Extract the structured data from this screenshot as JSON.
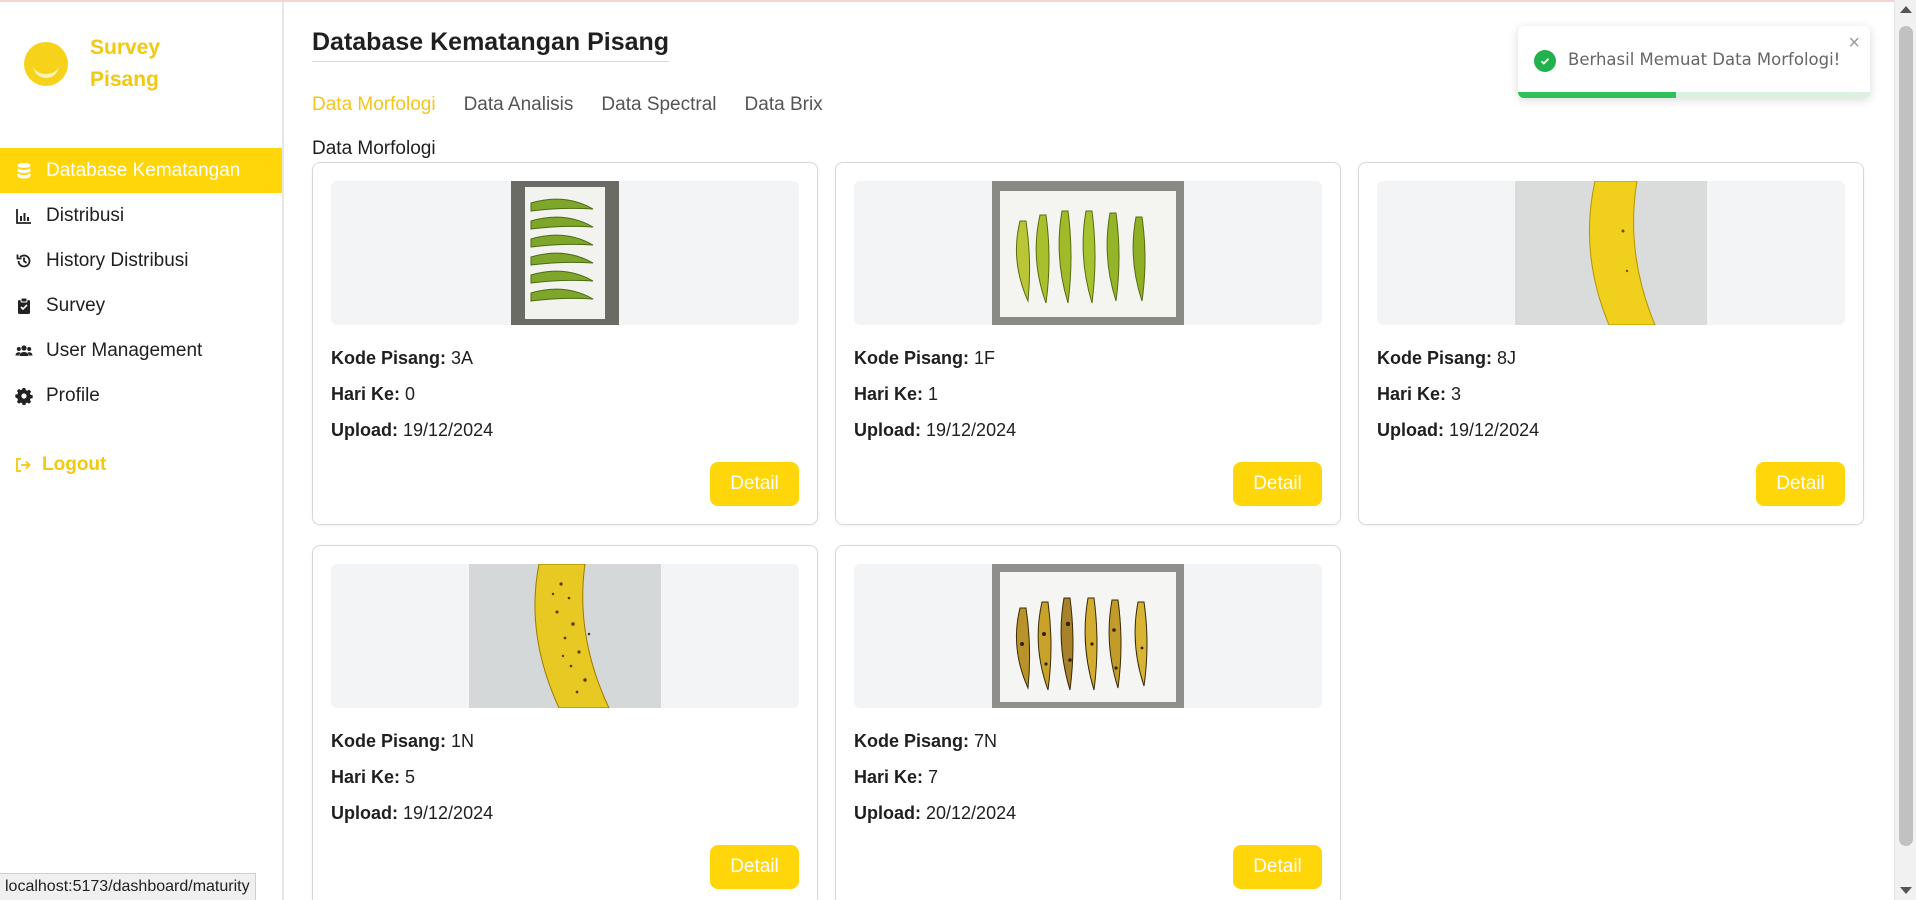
{
  "brand": {
    "line1": "Survey",
    "line2": "Pisang"
  },
  "sidebar": {
    "items": [
      {
        "label": "Database Kematangan",
        "icon": "database-icon",
        "active": true
      },
      {
        "label": "Distribusi",
        "icon": "chart-icon",
        "active": false
      },
      {
        "label": "History Distribusi",
        "icon": "history-icon",
        "active": false
      },
      {
        "label": "Survey",
        "icon": "clipboard-icon",
        "active": false
      },
      {
        "label": "User Management",
        "icon": "users-icon",
        "active": false
      },
      {
        "label": "Profile",
        "icon": "gear-icon",
        "active": false
      }
    ],
    "logout_label": "Logout"
  },
  "header": {
    "title": "Database Kematangan Pisang"
  },
  "tabs": [
    {
      "label": "Data Morfologi",
      "active": true
    },
    {
      "label": "Data Analisis",
      "active": false
    },
    {
      "label": "Data Spectral",
      "active": false
    },
    {
      "label": "Data Brix",
      "active": false
    }
  ],
  "section": {
    "title": "Data Morfologi"
  },
  "labels": {
    "kode": "Kode Pisang:",
    "hari": "Hari Ke:",
    "upload": "Upload:",
    "detail": "Detail"
  },
  "cards": [
    {
      "kode": "3A",
      "hari": "0",
      "upload": "19/12/2024",
      "image": "green-bananas-tray"
    },
    {
      "kode": "1F",
      "hari": "1",
      "upload": "19/12/2024",
      "image": "green-yellow-bananas-tray"
    },
    {
      "kode": "8J",
      "hari": "3",
      "upload": "19/12/2024",
      "image": "yellow-banana-closeup"
    },
    {
      "kode": "1N",
      "hari": "5",
      "upload": "19/12/2024",
      "image": "spotted-banana-closeup"
    },
    {
      "kode": "7N",
      "hari": "7",
      "upload": "20/12/2024",
      "image": "overripe-bananas-tray"
    }
  ],
  "toast": {
    "message": "Berhasil Memuat Data Morfologi!",
    "close": "×",
    "progress": 0.45,
    "color": "#22b14c"
  },
  "status_url": "localhost:5173/dashboard/maturity",
  "colors": {
    "accent": "#ffd60a",
    "brand": "#f2c811"
  }
}
